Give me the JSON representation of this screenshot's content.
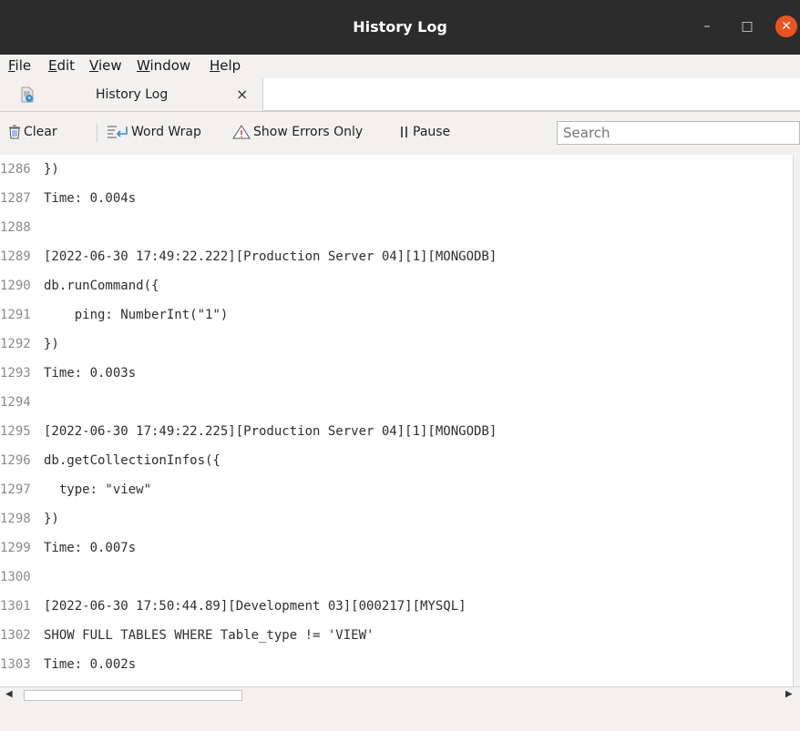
{
  "window": {
    "title": "History Log"
  },
  "menu": [
    {
      "label": "File",
      "accel": "F",
      "rest": "ile"
    },
    {
      "label": "Edit",
      "accel": "E",
      "rest": "dit"
    },
    {
      "label": "View",
      "accel": "V",
      "rest": "iew"
    },
    {
      "label": "Window",
      "accel": "W",
      "rest": "indow"
    },
    {
      "label": "Help",
      "accel": "H",
      "rest": "elp"
    }
  ],
  "tab": {
    "label": "History Log",
    "close": "×"
  },
  "toolbar": {
    "clear_label": "Clear",
    "word_wrap_label": "Word Wrap",
    "show_errors_label": "Show Errors Only",
    "pause_label": "Pause",
    "search_placeholder": "Search"
  },
  "log_lines": [
    {
      "n": "1286",
      "text": "})"
    },
    {
      "n": "1287",
      "text": "Time: 0.004s"
    },
    {
      "n": "1288",
      "text": ""
    },
    {
      "n": "1289",
      "text": "[2022-06-30 17:49:22.222][Production Server 04][1][MONGODB]"
    },
    {
      "n": "1290",
      "text": "db.runCommand({"
    },
    {
      "n": "1291",
      "text": "    ping: NumberInt(\"1\")"
    },
    {
      "n": "1292",
      "text": "})"
    },
    {
      "n": "1293",
      "text": "Time: 0.003s"
    },
    {
      "n": "1294",
      "text": ""
    },
    {
      "n": "1295",
      "text": "[2022-06-30 17:49:22.225][Production Server 04][1][MONGODB]"
    },
    {
      "n": "1296",
      "text": "db.getCollectionInfos({"
    },
    {
      "n": "1297",
      "text": "  type: \"view\""
    },
    {
      "n": "1298",
      "text": "})"
    },
    {
      "n": "1299",
      "text": "Time: 0.007s"
    },
    {
      "n": "1300",
      "text": ""
    },
    {
      "n": "1301",
      "text": "[2022-06-30 17:50:44.89][Development 03][000217][MYSQL]"
    },
    {
      "n": "1302",
      "text": "SHOW FULL TABLES WHERE Table_type != 'VIEW'"
    },
    {
      "n": "1303",
      "text": "Time: 0.002s"
    }
  ]
}
